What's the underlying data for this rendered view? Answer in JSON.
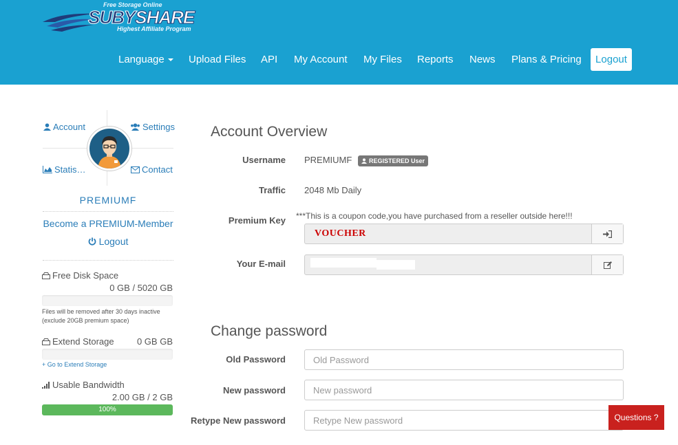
{
  "logo": {
    "top_text": "Free Storage Online",
    "brand_a": "SUBY",
    "brand_b": "SHARE",
    "bottom_text": "Highest Affiliate Program"
  },
  "nav": {
    "language": "Language",
    "upload": "Upload Files",
    "api": "API",
    "account": "My Account",
    "files": "My Files",
    "reports": "Reports",
    "news": "News",
    "plans": "Plans & Pricing",
    "logout": "Logout"
  },
  "sidebar": {
    "account": "Account",
    "settings": "Settings",
    "stats": "Statis…",
    "contact": "Contact",
    "username": "PREMIUMF",
    "premium_link": "Become a PREMIUM-Member",
    "logout": "Logout",
    "disk_label": "Free Disk Space",
    "disk_value": "0 GB / 5020 GB",
    "disk_percent": 0,
    "disk_note": "Files will be removed after 30 days inactive (exclude 20GB premium space)",
    "extend_label": "Extend Storage",
    "extend_value": "0 GB GB",
    "extend_percent": 0,
    "extend_link": "+ Go to Extend Storage",
    "bandwidth_label": "Usable Bandwidth",
    "bandwidth_value": "2.00 GB / 2 GB",
    "bandwidth_percent": 100,
    "bandwidth_bar_text": "100%"
  },
  "overview": {
    "title": "Account Overview",
    "username_label": "Username",
    "username_value": "PREMIUMF",
    "badge": "REGISTERED User",
    "traffic_label": "Traffic",
    "traffic_value": "2048 Mb Daily",
    "premium_key_label": "Premium Key",
    "premium_key_note": "***This is a coupon code,you have purchased from a reseller outside here!!!",
    "premium_key_value": "VOUCHER",
    "email_label": "Your E-mail"
  },
  "password": {
    "title": "Change password",
    "old_label": "Old Password",
    "old_placeholder": "Old Password",
    "new_label": "New password",
    "new_placeholder": "New password",
    "retype_label": "Retype New password",
    "retype_placeholder": "Retype New password"
  },
  "chat": {
    "label": "Questions ?"
  },
  "colors": {
    "header": "#1aa1d1",
    "link": "#2a7db8",
    "success": "#5cb85c",
    "chat": "#c9211e"
  }
}
